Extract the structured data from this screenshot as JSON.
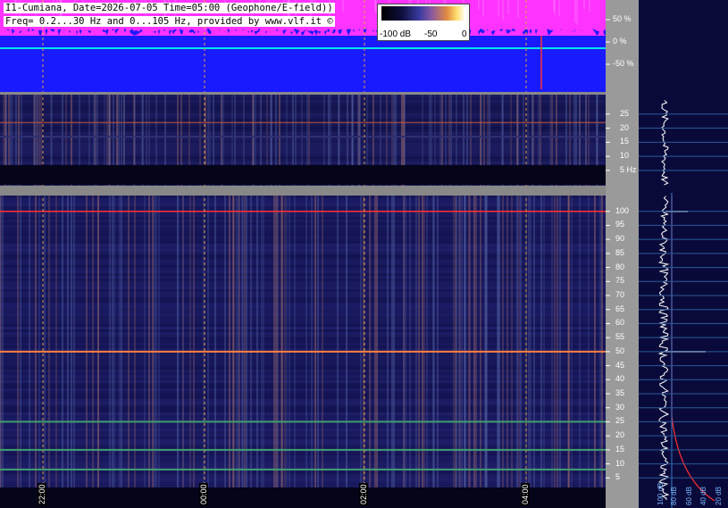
{
  "header": {
    "line1": "I1-Cumiana, Date=2026-07-05 Time=05:00 (Geophone/E-field))",
    "line2": "Freq= 0.2...30 Hz and 0...105 Hz, provided by www.vlf.it ©"
  },
  "colorscale": {
    "labels": [
      "-100 dB",
      "-50",
      "0"
    ]
  },
  "chart_data": [
    {
      "type": "line",
      "title": "",
      "ylabel": "",
      "y_ticks": [
        "50 %",
        "0 %",
        "-50 %"
      ],
      "ylim": [
        -100,
        100
      ],
      "series": [
        {
          "values": [
            0,
            0
          ]
        }
      ],
      "colors": {
        "background": "#1a1aff",
        "envelope": "#ff33ff",
        "trace": "#00e5e5"
      }
    },
    {
      "type": "heatmap",
      "title": "",
      "ylabel": "",
      "y_ticks": [
        "25",
        "20",
        "15",
        "10",
        "5 Hz"
      ],
      "ylim": [
        0.2,
        30
      ]
    },
    {
      "type": "heatmap",
      "title": "",
      "ylabel": "",
      "y_ticks": [
        "100",
        "95",
        "90",
        "85",
        "80",
        "75",
        "70",
        "65",
        "60",
        "55",
        "50",
        "45",
        "40",
        "35",
        "30",
        "25",
        "20",
        "15",
        "10",
        "5"
      ],
      "ylim": [
        0,
        105
      ],
      "x_ticks": [
        "22:00",
        "00:00",
        "02:00",
        "04:00"
      ],
      "strong_lines_hz": [
        100,
        50
      ]
    },
    {
      "type": "line",
      "title": "",
      "x_ticks_db": [
        "20 dB",
        "40 dB",
        "60 dB",
        "80 dB",
        "100 dB"
      ]
    }
  ]
}
